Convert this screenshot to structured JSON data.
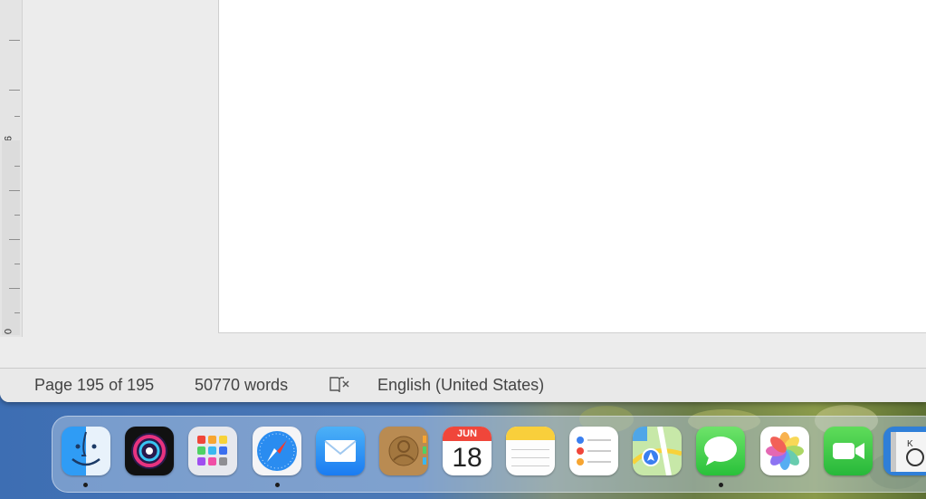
{
  "ruler": {
    "label_top": "9",
    "label_bottom": "0"
  },
  "status_bar": {
    "page": "Page 195 of 195",
    "words": "50770 words",
    "language": "English (United States)"
  },
  "dock": {
    "calendar": {
      "month": "JUN",
      "day": "18"
    }
  }
}
